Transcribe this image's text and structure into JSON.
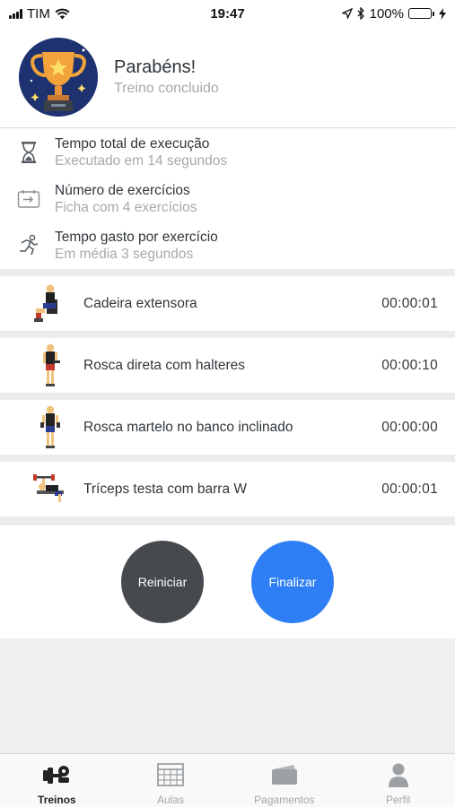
{
  "status_bar": {
    "carrier": "TIM",
    "time": "19:47",
    "battery": "100%",
    "battery_level": 1.0
  },
  "header": {
    "title": "Parabéns!",
    "subtitle": "Treino concluido",
    "icon": "trophy-icon"
  },
  "stats": [
    {
      "icon": "hourglass-icon",
      "title": "Tempo total de execução",
      "subtitle": "Executado em 14 segundos"
    },
    {
      "icon": "exercise-card-icon",
      "title": "Número de exercícios",
      "subtitle": "Ficha com 4 exercícios"
    },
    {
      "icon": "runner-icon",
      "title": "Tempo gasto por exercício",
      "subtitle": "Em média 3 segundos"
    }
  ],
  "exercises": [
    {
      "name": "Cadeira extensora",
      "time": "00:00:01"
    },
    {
      "name": "Rosca direta com halteres",
      "time": "00:00:10"
    },
    {
      "name": "Rosca martelo no banco inclinado",
      "time": "00:00:00"
    },
    {
      "name": "Tríceps testa com barra W",
      "time": "00:00:01"
    }
  ],
  "actions": {
    "restart_label": "Reiniciar",
    "finish_label": "Finalizar"
  },
  "tabs": [
    {
      "label": "Treinos",
      "icon": "dumbbell-icon",
      "active": true
    },
    {
      "label": "Aulas",
      "icon": "calendar-icon",
      "active": false
    },
    {
      "label": "Pagamentos",
      "icon": "wallet-icon",
      "active": false
    },
    {
      "label": "Perfil",
      "icon": "person-icon",
      "active": false
    }
  ],
  "colors": {
    "accent": "#2e7ef5",
    "restart": "#464a4f",
    "trophy_bg": "#1e3270",
    "battery": "#2ecc40"
  }
}
